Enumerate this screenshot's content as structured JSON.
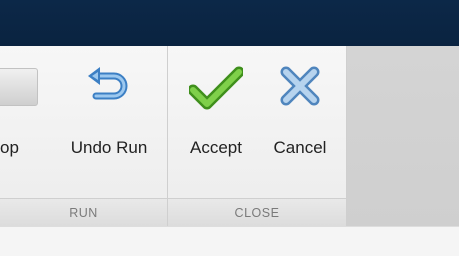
{
  "toolbar": {
    "stop_label": "Stop",
    "undo_run_label": "Undo Run",
    "accept_label": "Accept",
    "cancel_label": "Cancel"
  },
  "sections": {
    "run": "RUN",
    "close": "CLOSE"
  },
  "icons": {
    "stop": "stop-icon",
    "undo": "undo-arrow-icon",
    "accept": "checkmark-icon",
    "cancel": "x-icon"
  },
  "colors": {
    "title_bar": "#0c2848",
    "accept_green": "#5fb52a",
    "undo_blue": "#4a8fd1",
    "cancel_blue": "#8fb6dc"
  }
}
